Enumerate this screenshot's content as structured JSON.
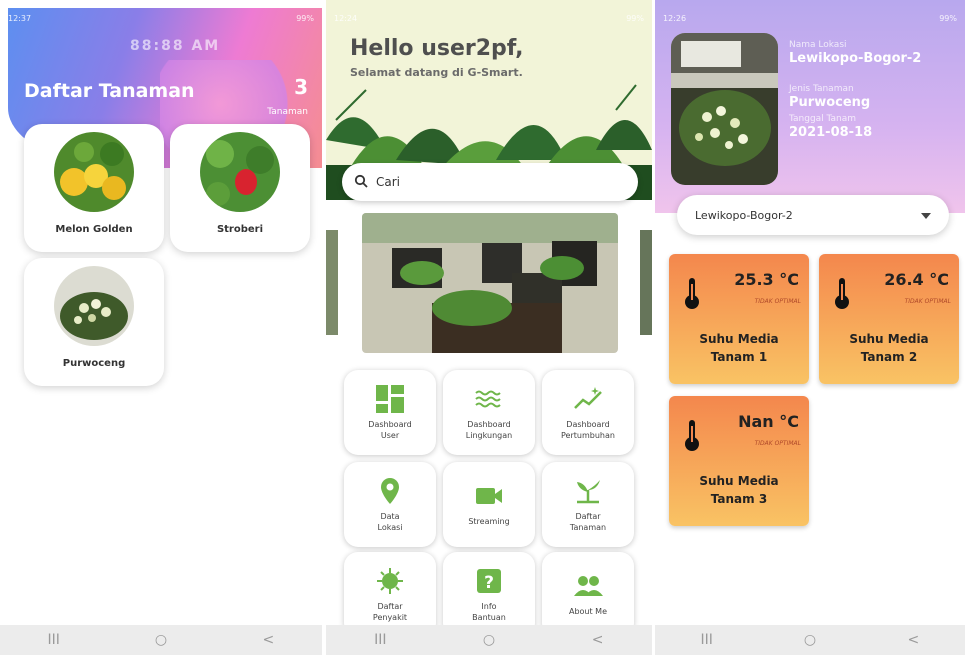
{
  "screen1": {
    "status_time": "12:37",
    "status_right": "99%",
    "clock_overlay": "88:88 AM",
    "title": "Daftar Tanaman",
    "count": "3",
    "count_label": "Tanaman",
    "plants": [
      {
        "name": "Melon Golden"
      },
      {
        "name": "Stroberi"
      },
      {
        "name": "Purwoceng"
      }
    ]
  },
  "screen2": {
    "status_time": "12:24",
    "status_right": "99%",
    "greeting": "Hello user2pf,",
    "subtitle": "Selamat datang di G-Smart.",
    "search_value": "Cari",
    "menu": [
      {
        "label": "Dashboard\nUser",
        "icon": "dashboard-grid-icon"
      },
      {
        "label": "Dashboard\nLingkungan",
        "icon": "waves-icon"
      },
      {
        "label": "Dashboard\nPertumbuhan",
        "icon": "growth-chart-icon"
      },
      {
        "label": "Data\nLokasi",
        "icon": "location-pin-icon"
      },
      {
        "label": "Streaming",
        "icon": "video-camera-icon"
      },
      {
        "label": "Daftar\nTanaman",
        "icon": "sprout-icon"
      },
      {
        "label": "Daftar\nPenyakit",
        "icon": "virus-icon"
      },
      {
        "label": "Info\nBantuan",
        "icon": "help-icon"
      },
      {
        "label": "About Me",
        "icon": "people-icon"
      }
    ],
    "colors": {
      "accent": "#6fb64a"
    }
  },
  "screen3": {
    "status_time": "12:26",
    "status_right": "99%",
    "location_key": "Nama Lokasi",
    "location_value": "Lewikopo-Bogor-2",
    "plant_key": "Jenis Tanaman",
    "plant_value": "Purwoceng",
    "date_key": "Tanggal Tanam",
    "date_value": "2021-08-18",
    "dropdown_value": "Lewikopo-Bogor-2",
    "sensors": [
      {
        "value": "25.3 °C",
        "status": "TIDAK OPTIMAL",
        "name": "Suhu Media\nTanam 1"
      },
      {
        "value": "26.4 °C",
        "status": "TIDAK OPTIMAL",
        "name": "Suhu Media\nTanam 2"
      },
      {
        "value": "Nan °C",
        "status": "TIDAK OPTIMAL",
        "name": "Suhu Media\nTanam 3"
      }
    ]
  },
  "navbar": {
    "recents": "III",
    "home": "○",
    "back": "<"
  }
}
